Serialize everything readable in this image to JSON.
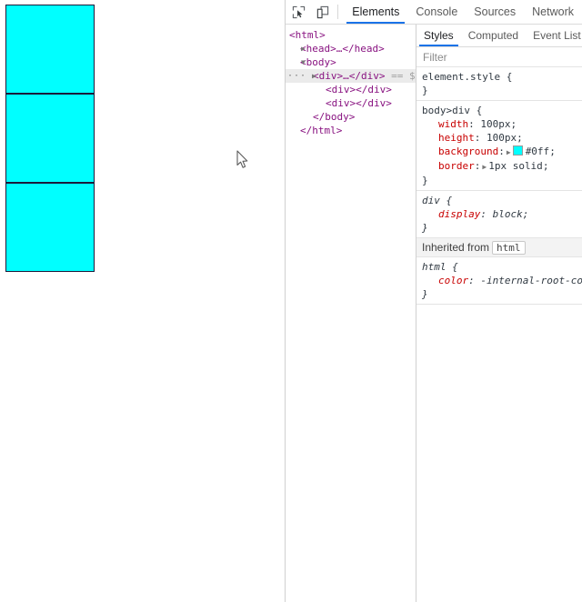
{
  "viewport": {
    "boxes": [
      {
        "label": "div-box-1",
        "color": "#00ffff"
      },
      {
        "label": "div-box-2",
        "color": "#00ffff"
      },
      {
        "label": "div-box-3",
        "color": "#00ffff"
      }
    ],
    "cursor": "arrow-pointer"
  },
  "devtools": {
    "toolbar": {
      "inspect_icon": "inspect-element-icon",
      "device_icon": "device-toolbar-icon",
      "tabs": [
        {
          "label": "Elements",
          "active": true
        },
        {
          "label": "Console",
          "active": false
        },
        {
          "label": "Sources",
          "active": false
        },
        {
          "label": "Network",
          "active": false
        }
      ]
    },
    "dom_tree": [
      {
        "text": "<html>",
        "tag": "html",
        "indent": 0,
        "twisty": "",
        "selected": false,
        "suffix": ""
      },
      {
        "text": "<head>…</head>",
        "tag": "head",
        "indent": 1,
        "twisty": "closed",
        "selected": false,
        "suffix": ""
      },
      {
        "text": "<body>",
        "tag": "body",
        "indent": 1,
        "twisty": "open",
        "selected": false,
        "suffix": ""
      },
      {
        "text": "<div>…</div>",
        "tag": "div",
        "indent": 2,
        "twisty": "sel",
        "selected": true,
        "suffix": "== $"
      },
      {
        "text": "<div></div>",
        "tag": "div",
        "indent": 3,
        "twisty": "",
        "selected": false,
        "suffix": ""
      },
      {
        "text": "<div></div>",
        "tag": "div",
        "indent": 3,
        "twisty": "",
        "selected": false,
        "suffix": ""
      },
      {
        "text": "</body>",
        "tag": "body",
        "indent": 2,
        "twisty": "",
        "selected": false,
        "suffix": ""
      },
      {
        "text": "</html>",
        "tag": "html",
        "indent": 1,
        "twisty": "",
        "selected": false,
        "suffix": ""
      }
    ],
    "styles": {
      "tabs": [
        {
          "label": "Styles",
          "active": true
        },
        {
          "label": "Computed",
          "active": false
        },
        {
          "label": "Event List",
          "active": false
        }
      ],
      "filter_placeholder": "Filter",
      "filter_value": "",
      "rules": [
        {
          "selector": "element.style",
          "ua": false,
          "declarations": []
        },
        {
          "selector": "body>div",
          "ua": false,
          "declarations": [
            {
              "name": "width",
              "value": "100px",
              "arrow": false,
              "swatch": false
            },
            {
              "name": "height",
              "value": "100px",
              "arrow": false,
              "swatch": false
            },
            {
              "name": "background",
              "value": "#0ff",
              "arrow": true,
              "swatch": true,
              "swatch_color": "#00ffff"
            },
            {
              "name": "border",
              "value": "1px solid",
              "arrow": true,
              "swatch": false
            }
          ]
        },
        {
          "selector": "div",
          "ua": true,
          "declarations": [
            {
              "name": "display",
              "value": "block",
              "arrow": false,
              "swatch": false
            }
          ]
        }
      ],
      "inherited_label": "Inherited from",
      "inherited_source": "html",
      "inherited_rules": [
        {
          "selector": "html",
          "ua": true,
          "declarations": [
            {
              "name": "color",
              "value": "-internal-root-col",
              "arrow": false,
              "swatch": false
            }
          ]
        }
      ]
    }
  }
}
